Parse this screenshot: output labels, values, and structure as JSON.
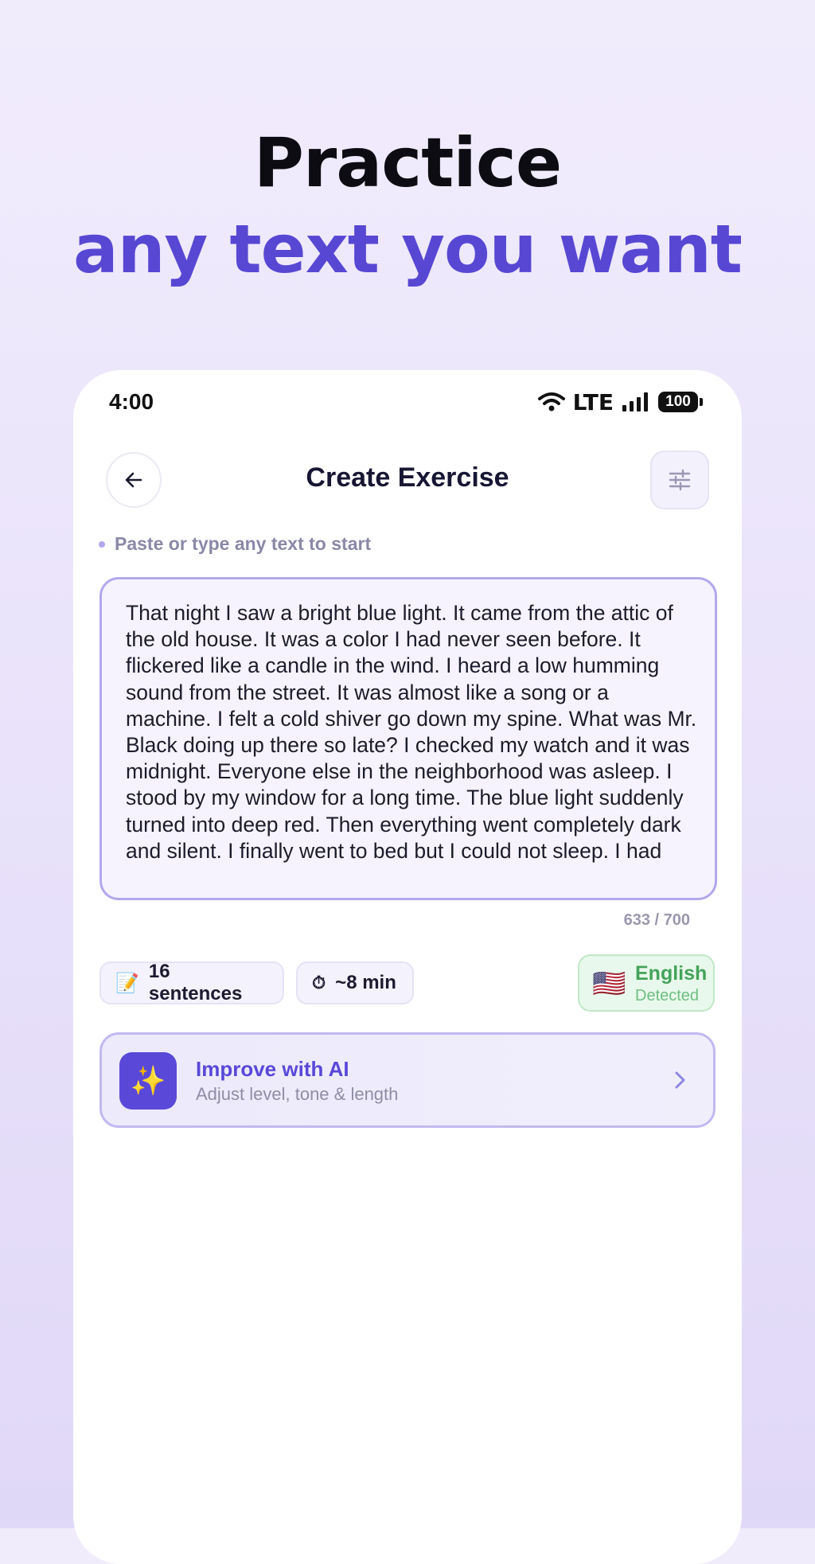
{
  "hero": {
    "line1": "Practice",
    "line2": "any text you want"
  },
  "status_bar": {
    "time": "4:00",
    "network": "LTE",
    "battery": "100"
  },
  "header": {
    "title": "Create Exercise",
    "back_icon": "arrow-left-icon",
    "settings_icon": "sliders-icon"
  },
  "hint": "Paste or type any text to start",
  "editor": {
    "text": "That night I saw a bright blue light. It came from the attic of the old house. It was a color I had never seen before. It flickered like a candle in the wind. I heard a low humming sound from the street. It was almost like a song or a machine. I felt a cold shiver go down my spine. What was Mr. Black doing up there so late? I checked my watch and it was midnight. Everyone else in the neighborhood was asleep. I stood by my window for a long time. The blue light suddenly turned into deep red. Then everything went completely dark and silent. I finally went to bed but I could not sleep. I had",
    "counter": "633 / 700"
  },
  "stats": {
    "sentences_icon": "📝",
    "sentences": "16 sentences",
    "time_icon": "⏱",
    "time": "~8 min"
  },
  "language": {
    "flag": "🇺🇸",
    "name": "English",
    "status": "Detected"
  },
  "ai_card": {
    "icon": "✨",
    "title": "Improve with AI",
    "subtitle": "Adjust level, tone & length"
  },
  "colors": {
    "accent": "#5a48d8",
    "success": "#44a35a"
  }
}
